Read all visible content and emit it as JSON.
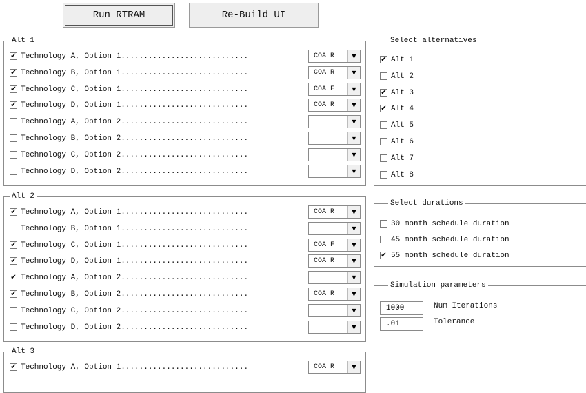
{
  "buttons": {
    "run": "Run RTRAM",
    "rebuild": "Re-Build UI"
  },
  "alt_groups": [
    {
      "title": "Alt 1",
      "rows": [
        {
          "checked": true,
          "label": "Technology A, Option 1............................",
          "combo": "COA R"
        },
        {
          "checked": true,
          "label": "Technology B, Option 1............................",
          "combo": "COA R"
        },
        {
          "checked": true,
          "label": "Technology C, Option 1............................",
          "combo": "COA F"
        },
        {
          "checked": true,
          "label": "Technology D, Option 1............................",
          "combo": "COA R"
        },
        {
          "checked": false,
          "label": "Technology A, Option 2............................",
          "combo": ""
        },
        {
          "checked": false,
          "label": "Technology B, Option 2............................",
          "combo": ""
        },
        {
          "checked": false,
          "label": "Technology C, Option 2............................",
          "combo": ""
        },
        {
          "checked": false,
          "label": "Technology D, Option 2............................",
          "combo": ""
        }
      ]
    },
    {
      "title": "Alt 2",
      "rows": [
        {
          "checked": true,
          "label": "Technology A, Option 1............................",
          "combo": "COA R"
        },
        {
          "checked": false,
          "label": "Technology B, Option 1............................",
          "combo": ""
        },
        {
          "checked": true,
          "label": "Technology C, Option 1............................",
          "combo": "COA F"
        },
        {
          "checked": true,
          "label": "Technology D, Option 1............................",
          "combo": "COA R"
        },
        {
          "checked": true,
          "label": "Technology A, Option 2............................",
          "combo": ""
        },
        {
          "checked": true,
          "label": "Technology B, Option 2............................",
          "combo": "COA R"
        },
        {
          "checked": false,
          "label": "Technology C, Option 2............................",
          "combo": ""
        },
        {
          "checked": false,
          "label": "Technology D, Option 2............................",
          "combo": ""
        }
      ]
    },
    {
      "title": "Alt 3",
      "rows": [
        {
          "checked": true,
          "label": "Technology A, Option 1............................",
          "combo": "COA R"
        }
      ]
    }
  ],
  "select_alternatives": {
    "title": "Select alternatives",
    "items": [
      {
        "checked": true,
        "label": "Alt 1"
      },
      {
        "checked": false,
        "label": "Alt 2"
      },
      {
        "checked": true,
        "label": "Alt 3"
      },
      {
        "checked": true,
        "label": "Alt 4"
      },
      {
        "checked": false,
        "label": "Alt 5"
      },
      {
        "checked": false,
        "label": "Alt 6"
      },
      {
        "checked": false,
        "label": "Alt 7"
      },
      {
        "checked": false,
        "label": "Alt 8"
      }
    ]
  },
  "select_durations": {
    "title": "Select durations",
    "items": [
      {
        "checked": false,
        "label": "30 month schedule duration"
      },
      {
        "checked": false,
        "label": "45 month schedule duration"
      },
      {
        "checked": true,
        "label": "55 month schedule duration"
      }
    ]
  },
  "simulation": {
    "title": "Simulation parameters",
    "iterations_value": "1000",
    "iterations_label": "Num Iterations",
    "tolerance_value": ".01",
    "tolerance_label": "Tolerance"
  },
  "glyphs": {
    "check": "✔",
    "dropdown_arrow": "▼"
  }
}
